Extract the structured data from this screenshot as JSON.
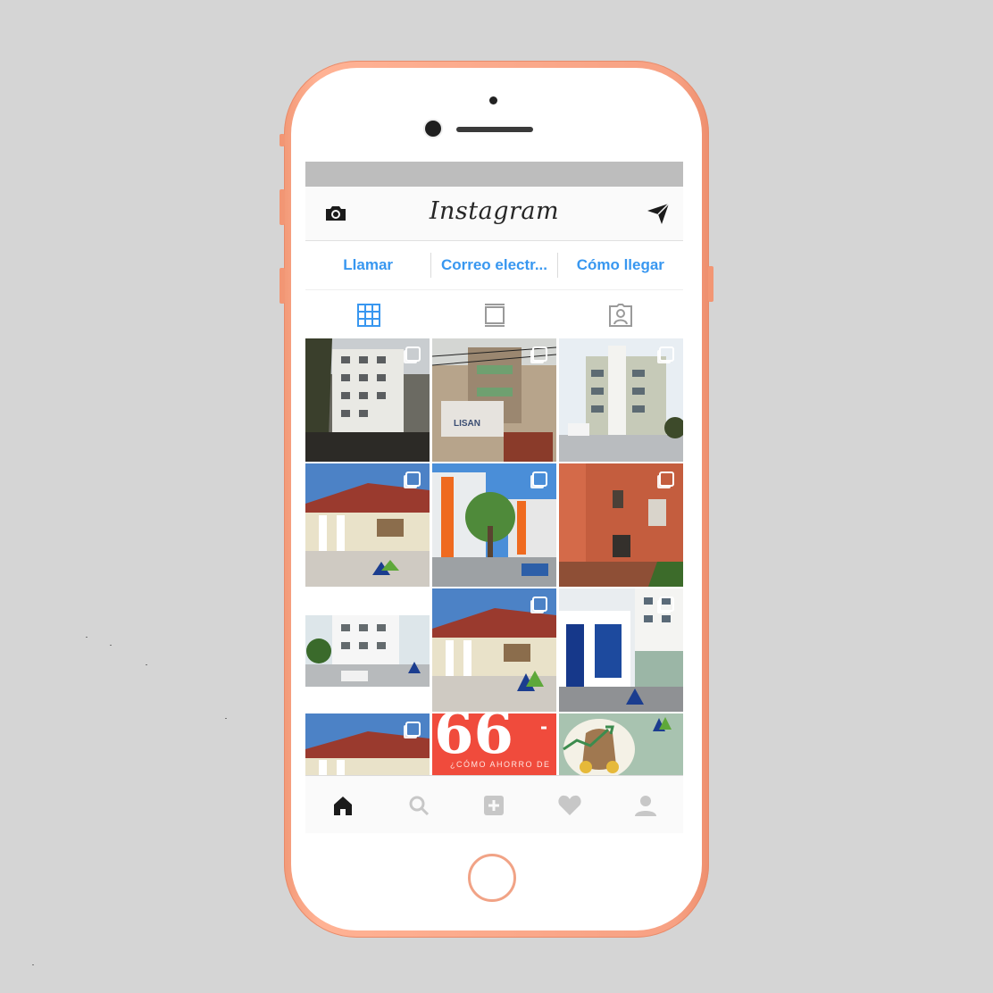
{
  "app": {
    "logo_text": "Instagram"
  },
  "header": {
    "left_icon": "camera-icon",
    "right_icon": "send-direct-icon"
  },
  "actions": [
    {
      "label": "Llamar"
    },
    {
      "label": "Correo electr..."
    },
    {
      "label": "Cómo llegar"
    }
  ],
  "view_tabs": [
    {
      "icon": "grid-view-icon",
      "active": true
    },
    {
      "icon": "feed-view-icon",
      "active": false
    },
    {
      "icon": "tagged-view-icon",
      "active": false
    }
  ],
  "posts": [
    {
      "kind": "tower",
      "multi": true
    },
    {
      "kind": "construction",
      "multi": true
    },
    {
      "kind": "gray-building",
      "multi": true
    },
    {
      "kind": "house",
      "multi": true
    },
    {
      "kind": "orange-complex",
      "multi": true
    },
    {
      "kind": "orange-wall",
      "multi": true
    },
    {
      "kind": "white-building",
      "multi": true
    },
    {
      "kind": "house",
      "multi": true
    },
    {
      "kind": "blue-white",
      "multi": true
    },
    {
      "kind": "house-partial",
      "multi": true
    },
    {
      "kind": "red-quote",
      "multi": false,
      "caption": "¿CÓMO AHORRO DE"
    },
    {
      "kind": "money-bag",
      "multi": false
    }
  ],
  "bottom_nav": [
    {
      "icon": "home-icon",
      "active": true
    },
    {
      "icon": "search-icon",
      "active": false
    },
    {
      "icon": "add-post-icon",
      "active": false
    },
    {
      "icon": "heart-icon",
      "active": false
    },
    {
      "icon": "profile-icon",
      "active": false
    }
  ],
  "colors": {
    "accent": "#3897f0",
    "phone_frame": "#f7a183",
    "background": "#d5d5d5"
  }
}
